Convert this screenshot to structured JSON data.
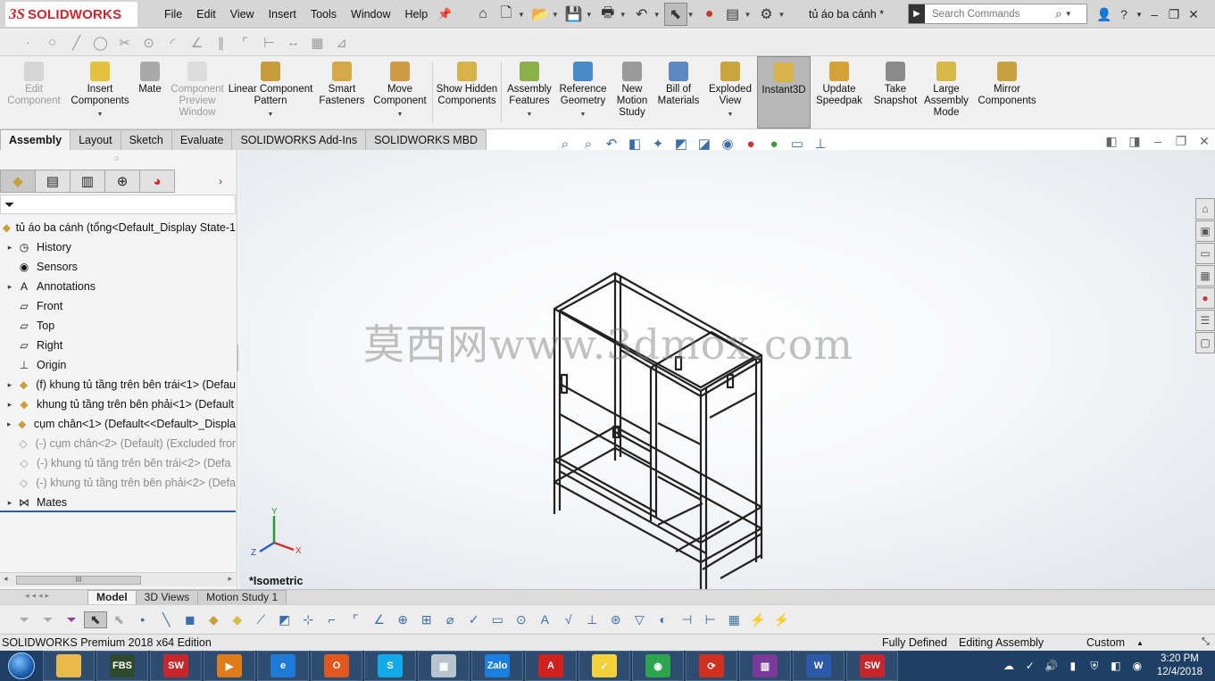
{
  "app": {
    "brand_ds": "3S",
    "brand_name": "SOLIDWORKS"
  },
  "menu": [
    "File",
    "Edit",
    "View",
    "Insert",
    "Tools",
    "Window",
    "Help"
  ],
  "document_title": "tủ áo  ba cánh *",
  "search": {
    "placeholder": "Search Commands"
  },
  "command_manager": {
    "buttons": [
      {
        "label": "Edit Component",
        "enabled": false
      },
      {
        "label": "Insert Components",
        "enabled": true
      },
      {
        "label": "Mate",
        "enabled": true
      },
      {
        "label": "Component Preview Window",
        "enabled": false
      },
      {
        "label": "Linear Component Pattern",
        "enabled": true
      },
      {
        "label": "Smart Fasteners",
        "enabled": true
      },
      {
        "label": "Move Component",
        "enabled": true
      },
      {
        "label": "Show Hidden Components",
        "enabled": true
      },
      {
        "label": "Assembly Features",
        "enabled": true
      },
      {
        "label": "Reference Geometry",
        "enabled": true
      },
      {
        "label": "New Motion Study",
        "enabled": true
      },
      {
        "label": "Bill of Materials",
        "enabled": true
      },
      {
        "label": "Exploded View",
        "enabled": true
      },
      {
        "label": "Instant3D",
        "enabled": true,
        "active": true
      },
      {
        "label": "Update Speedpak",
        "enabled": true
      },
      {
        "label": "Take Snapshot",
        "enabled": true
      },
      {
        "label": "Large Assembly Mode",
        "enabled": true
      },
      {
        "label": "Mirror Components",
        "enabled": true
      }
    ]
  },
  "cm_tabs": [
    "Assembly",
    "Layout",
    "Sketch",
    "Evaluate",
    "SOLIDWORKS Add-Ins",
    "SOLIDWORKS MBD"
  ],
  "feature_tree": {
    "root": "tủ áo  ba cánh  (tổng<Default_Display State-1",
    "items": [
      {
        "label": "History",
        "icon": "history-icon",
        "expand": true,
        "state": "normal"
      },
      {
        "label": "Sensors",
        "icon": "sensors-icon",
        "expand": false,
        "state": "normal"
      },
      {
        "label": "Annotations",
        "icon": "annotations-icon",
        "expand": true,
        "state": "normal"
      },
      {
        "label": "Front",
        "icon": "plane-icon",
        "expand": false,
        "state": "normal"
      },
      {
        "label": "Top",
        "icon": "plane-icon",
        "expand": false,
        "state": "normal"
      },
      {
        "label": "Right",
        "icon": "plane-icon",
        "expand": false,
        "state": "normal"
      },
      {
        "label": "Origin",
        "icon": "origin-icon",
        "expand": false,
        "state": "normal"
      },
      {
        "label": "(f) khung tủ tầng  trên bên trái<1> (Defau",
        "icon": "subassembly-icon",
        "expand": true,
        "state": "normal"
      },
      {
        "label": "khung tủ tầng trên bên phải<1> (Default",
        "icon": "subassembly-icon",
        "expand": true,
        "state": "normal"
      },
      {
        "label": "cụm chân<1> (Default<<Default>_Displa",
        "icon": "subassembly-icon",
        "expand": true,
        "state": "normal"
      },
      {
        "label": "(-) cụm chân<2> (Default) (Excluded fror",
        "icon": "excluded-subassembly-icon",
        "expand": false,
        "state": "grey"
      },
      {
        "label": "(-) khung tủ tầng  trên bên trái<2> (Defa",
        "icon": "excluded-subassembly-icon",
        "expand": false,
        "state": "grey"
      },
      {
        "label": "(-) khung tủ tầng trên bên phải<2> (Defa",
        "icon": "excluded-subassembly-icon",
        "expand": false,
        "state": "grey"
      },
      {
        "label": "Mates",
        "icon": "mates-icon",
        "expand": true,
        "state": "normal"
      }
    ]
  },
  "viewport": {
    "watermark": "莫西网www.3dmox.com",
    "view_label": "*Isometric",
    "axis_labels": {
      "x": "X",
      "y": "Y",
      "z": "Z"
    }
  },
  "bottom_tabs": [
    "Model",
    "3D Views",
    "Motion Study 1"
  ],
  "status_bar": {
    "edition": "SOLIDWORKS Premium 2018 x64 Edition",
    "defined": "Fully Defined",
    "mode": "Editing Assembly",
    "units": "Custom"
  },
  "taskbar": {
    "apps": [
      {
        "name": "explorer",
        "label": "",
        "color": "#e8b84a"
      },
      {
        "name": "fbs",
        "label": "FBS",
        "color": "#2e4a2e"
      },
      {
        "name": "solidworks-2018",
        "label": "SW",
        "color": "#c8262c"
      },
      {
        "name": "media",
        "label": "▶",
        "color": "#e07b1a"
      },
      {
        "name": "internet-explorer",
        "label": "e",
        "color": "#1f7ad6"
      },
      {
        "name": "office",
        "label": "O",
        "color": "#e2571e"
      },
      {
        "name": "skype",
        "label": "S",
        "color": "#11a9e8"
      },
      {
        "name": "calculator",
        "label": "▦",
        "color": "#b8c3d0"
      },
      {
        "name": "zalo",
        "label": "Zalo",
        "color": "#1a7fe0"
      },
      {
        "name": "acrobat",
        "label": "A",
        "color": "#d02020"
      },
      {
        "name": "sticky-notes",
        "label": "✓",
        "color": "#f2d13a"
      },
      {
        "name": "chrome",
        "label": "◉",
        "color": "#2da44e"
      },
      {
        "name": "pdf",
        "label": "⟳",
        "color": "#d2301e"
      },
      {
        "name": "winrar",
        "label": "▥",
        "color": "#7a3a9a"
      },
      {
        "name": "word",
        "label": "W",
        "color": "#2a5aa8"
      },
      {
        "name": "solidworks-2018b",
        "label": "SW",
        "color": "#c8262c"
      }
    ],
    "clock_time": "3:20 PM",
    "clock_date": "12/4/2018"
  }
}
